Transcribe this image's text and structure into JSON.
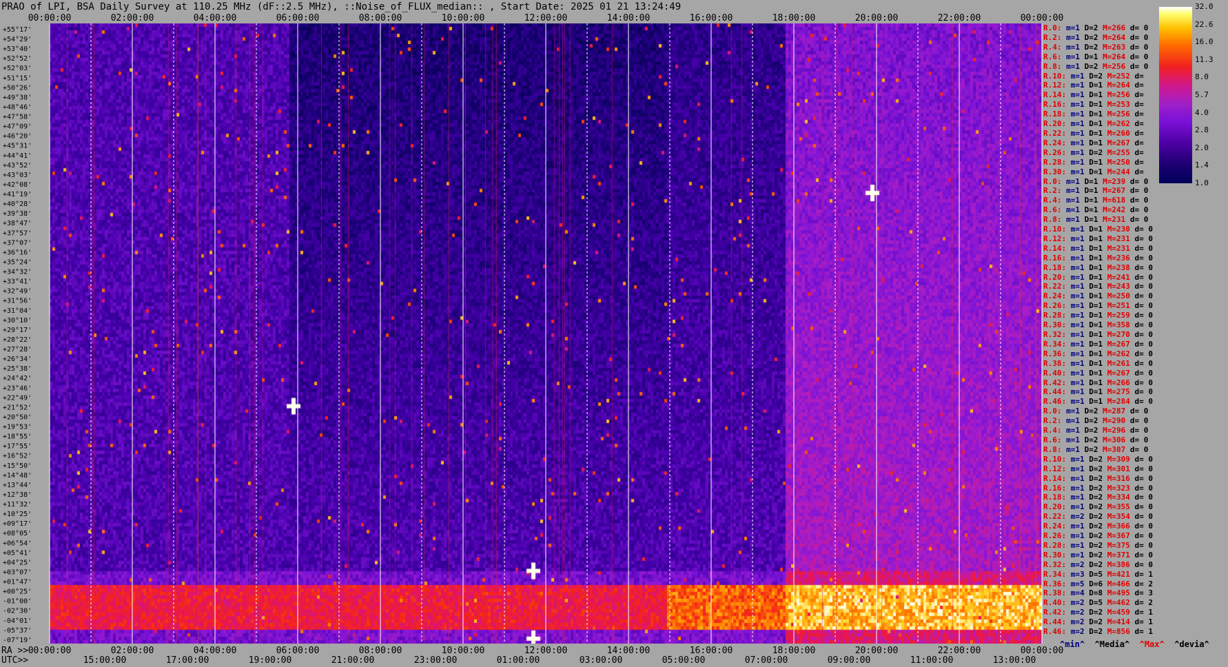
{
  "title": "PRAO of LPI, BSA Daily Survey at 110.25 MHz (dF::2.5 MHz), ::Noise_of_FLUX_median:: , Start Date: 2025 01 21 13:24:49",
  "colorbar": {
    "ticks": [
      "32.0",
      "22.6",
      "16.0",
      "11.3",
      "8.0",
      "5.7",
      "4.0",
      "2.8",
      "2.0",
      "1.4",
      "1.0"
    ]
  },
  "bottom_legend": {
    "min": "^min^",
    "median": "^Media^",
    "max": "^Max^",
    "devia": "^devia^"
  },
  "axis": {
    "ra_label": "RA >>",
    "utc_label": "UTC>>",
    "top_ticks": [
      "00:00:00",
      "02:00:00",
      "04:00:00",
      "06:00:00",
      "08:00:00",
      "10:00:00",
      "12:00:00",
      "14:00:00",
      "16:00:00",
      "18:00:00",
      "20:00:00",
      "22:00:00",
      "00:00:00"
    ],
    "ra_ticks": [
      "00:00:00",
      "02:00:00",
      "04:00:00",
      "06:00:00",
      "08:00:00",
      "10:00:00",
      "12:00:00",
      "14:00:00",
      "16:00:00",
      "18:00:00",
      "20:00:00",
      "22:00:00",
      "00:00:00"
    ],
    "utc_ticks": [
      "15:00:00",
      "17:00:00",
      "19:00:00",
      "21:00:00",
      "23:00:00",
      "01:00:00",
      "03:00:00",
      "05:00:00",
      "07:00:00",
      "09:00:00",
      "11:00:00",
      "13:00:00"
    ]
  },
  "declinations": [
    "+55°17'",
    "+54°29'",
    "+53°40'",
    "+52°52'",
    "+52°03'",
    "+51°15'",
    "+50°26'",
    "+49°38'",
    "+48°46'",
    "+47°58'",
    "+47°09'",
    "+46°20'",
    "+45°31'",
    "+44°41'",
    "+43°52'",
    "+43°03'",
    "+42°08'",
    "+41°19'",
    "+40°28'",
    "+39°38'",
    "+38°47'",
    "+37°57'",
    "+37°07'",
    "+36°16'",
    "+35°24'",
    "+34°32'",
    "+33°41'",
    "+32°49'",
    "+31°56'",
    "+31°04'",
    "+30°10'",
    "+29°17'",
    "+28°22'",
    "+27°28'",
    "+26°34'",
    "+25°38'",
    "+24°42'",
    "+23°46'",
    "+22°49'",
    "+21°52'",
    "+20°50'",
    "+19°53'",
    "+18°55'",
    "+17°55'",
    "+16°52'",
    "+15°50'",
    "+14°48'",
    "+13°44'",
    "+12°38'",
    "+11°32'",
    "+10°25'",
    "+09°17'",
    "+08°05'",
    "+06°54'",
    "+05°41'",
    "+04°25'",
    "+03°07'",
    "+01°47'",
    "+00°25'",
    "-01°00'",
    "-02°30'",
    "-04°01'",
    "-05°37'",
    "-07°19'"
  ],
  "right_rows": [
    {
      "r": "R.0:",
      "m": "m=1",
      "d": "D=2",
      "h": "M=266",
      "v": "d= 0"
    },
    {
      "r": "R.2:",
      "m": "m=1",
      "d": "D=2",
      "h": "M=264",
      "v": "d= 0"
    },
    {
      "r": "R.4:",
      "m": "m=1",
      "d": "D=2",
      "h": "M=263",
      "v": "d= 0"
    },
    {
      "r": "R.6:",
      "m": "m=1",
      "d": "D=1",
      "h": "M=264",
      "v": "d= 0"
    },
    {
      "r": "R.8:",
      "m": "m=1",
      "d": "D=2",
      "h": "M=256",
      "v": "d= 0"
    },
    {
      "r": "R.10:",
      "m": "m=1",
      "d": "D=2",
      "h": "M=252",
      "v": "d="
    },
    {
      "r": "R.12:",
      "m": "m=1",
      "d": "D=1",
      "h": "M=264",
      "v": "d="
    },
    {
      "r": "R.14:",
      "m": "m=1",
      "d": "D=1",
      "h": "M=256",
      "v": "d="
    },
    {
      "r": "R.16:",
      "m": "m=1",
      "d": "D=1",
      "h": "M=253",
      "v": "d="
    },
    {
      "r": "R.18:",
      "m": "m=1",
      "d": "D=1",
      "h": "M=256",
      "v": "d="
    },
    {
      "r": "R.20:",
      "m": "m=1",
      "d": "D=1",
      "h": "M=262",
      "v": "d="
    },
    {
      "r": "R.22:",
      "m": "m=1",
      "d": "D=1",
      "h": "M=260",
      "v": "d="
    },
    {
      "r": "R.24:",
      "m": "m=1",
      "d": "D=1",
      "h": "M=267",
      "v": "d="
    },
    {
      "r": "R.26:",
      "m": "m=1",
      "d": "D=2",
      "h": "M=255",
      "v": "d="
    },
    {
      "r": "R.28:",
      "m": "m=1",
      "d": "D=1",
      "h": "M=250",
      "v": "d="
    },
    {
      "r": "R.30:",
      "m": "m=1",
      "d": "D=1",
      "h": "M=244",
      "v": "d="
    },
    {
      "r": "R.0:",
      "m": "m=1",
      "d": "D=1",
      "h": "M=239",
      "v": "d= 0"
    },
    {
      "r": "R.2:",
      "m": "m=1",
      "d": "D=1",
      "h": "M=267",
      "v": "d= 0"
    },
    {
      "r": "R.4:",
      "m": "m=1",
      "d": "D=1",
      "h": "M=618",
      "v": "d= 0"
    },
    {
      "r": "R.6:",
      "m": "m=1",
      "d": "D=1",
      "h": "M=242",
      "v": "d= 0"
    },
    {
      "r": "R.8:",
      "m": "m=1",
      "d": "D=1",
      "h": "M=231",
      "v": "d= 0"
    },
    {
      "r": "R.10:",
      "m": "m=1",
      "d": "D=1",
      "h": "M=230",
      "v": "d= 0"
    },
    {
      "r": "R.12:",
      "m": "m=1",
      "d": "D=1",
      "h": "M=231",
      "v": "d= 0"
    },
    {
      "r": "R.14:",
      "m": "m=1",
      "d": "D=1",
      "h": "M=231",
      "v": "d= 0"
    },
    {
      "r": "R.16:",
      "m": "m=1",
      "d": "D=1",
      "h": "M=236",
      "v": "d= 0"
    },
    {
      "r": "R.18:",
      "m": "m=1",
      "d": "D=1",
      "h": "M=238",
      "v": "d= 0"
    },
    {
      "r": "R.20:",
      "m": "m=1",
      "d": "D=1",
      "h": "M=241",
      "v": "d= 0"
    },
    {
      "r": "R.22:",
      "m": "m=1",
      "d": "D=1",
      "h": "M=243",
      "v": "d= 0"
    },
    {
      "r": "R.24:",
      "m": "m=1",
      "d": "D=1",
      "h": "M=250",
      "v": "d= 0"
    },
    {
      "r": "R.26:",
      "m": "m=1",
      "d": "D=1",
      "h": "M=251",
      "v": "d= 0"
    },
    {
      "r": "R.28:",
      "m": "m=1",
      "d": "D=1",
      "h": "M=259",
      "v": "d= 0"
    },
    {
      "r": "R.30:",
      "m": "m=1",
      "d": "D=1",
      "h": "M=358",
      "v": "d= 0"
    },
    {
      "r": "R.32:",
      "m": "m=1",
      "d": "D=1",
      "h": "M=270",
      "v": "d= 0"
    },
    {
      "r": "R.34:",
      "m": "m=1",
      "d": "D=1",
      "h": "M=267",
      "v": "d= 0"
    },
    {
      "r": "R.36:",
      "m": "m=1",
      "d": "D=1",
      "h": "M=262",
      "v": "d= 0"
    },
    {
      "r": "R.38:",
      "m": "m=1",
      "d": "D=1",
      "h": "M=261",
      "v": "d= 0"
    },
    {
      "r": "R.40:",
      "m": "m=1",
      "d": "D=1",
      "h": "M=267",
      "v": "d= 0"
    },
    {
      "r": "R.42:",
      "m": "m=1",
      "d": "D=1",
      "h": "M=266",
      "v": "d= 0"
    },
    {
      "r": "R.44:",
      "m": "m=1",
      "d": "D=1",
      "h": "M=275",
      "v": "d= 0"
    },
    {
      "r": "R.46:",
      "m": "m=1",
      "d": "D=1",
      "h": "M=284",
      "v": "d= 0"
    },
    {
      "r": "R.0:",
      "m": "m=1",
      "d": "D=2",
      "h": "M=287",
      "v": "d= 0"
    },
    {
      "r": "R.2:",
      "m": "m=1",
      "d": "D=2",
      "h": "M=290",
      "v": "d= 0"
    },
    {
      "r": "R.4:",
      "m": "m=1",
      "d": "D=2",
      "h": "M=296",
      "v": "d= 0"
    },
    {
      "r": "R.6:",
      "m": "m=1",
      "d": "D=2",
      "h": "M=306",
      "v": "d= 0"
    },
    {
      "r": "R.8:",
      "m": "m=1",
      "d": "D=2",
      "h": "M=307",
      "v": "d= 0"
    },
    {
      "r": "R.10:",
      "m": "m=1",
      "d": "D=2",
      "h": "M=309",
      "v": "d= 0"
    },
    {
      "r": "R.12:",
      "m": "m=1",
      "d": "D=2",
      "h": "M=301",
      "v": "d= 0"
    },
    {
      "r": "R.14:",
      "m": "m=1",
      "d": "D=2",
      "h": "M=316",
      "v": "d= 0"
    },
    {
      "r": "R.16:",
      "m": "m=1",
      "d": "D=2",
      "h": "M=323",
      "v": "d= 0"
    },
    {
      "r": "R.18:",
      "m": "m=1",
      "d": "D=2",
      "h": "M=334",
      "v": "d= 0"
    },
    {
      "r": "R.20:",
      "m": "m=1",
      "d": "D=2",
      "h": "M=355",
      "v": "d= 0"
    },
    {
      "r": "R.22:",
      "m": "m=2",
      "d": "D=2",
      "h": "M=354",
      "v": "d= 0"
    },
    {
      "r": "R.24:",
      "m": "m=1",
      "d": "D=2",
      "h": "M=366",
      "v": "d= 0"
    },
    {
      "r": "R.26:",
      "m": "m=1",
      "d": "D=2",
      "h": "M=367",
      "v": "d= 0"
    },
    {
      "r": "R.28:",
      "m": "m=1",
      "d": "D=2",
      "h": "M=375",
      "v": "d= 0"
    },
    {
      "r": "R.30:",
      "m": "m=1",
      "d": "D=2",
      "h": "M=371",
      "v": "d= 0"
    },
    {
      "r": "R.32:",
      "m": "m=2",
      "d": "D=2",
      "h": "M=386",
      "v": "d= 0"
    },
    {
      "r": "R.34:",
      "m": "m=3",
      "d": "D=5",
      "h": "M=421",
      "v": "d= 1"
    },
    {
      "r": "R.36:",
      "m": "m=5",
      "d": "D=6",
      "h": "M=466",
      "v": "d= 2"
    },
    {
      "r": "R.38:",
      "m": "m=4",
      "d": "D=8",
      "h": "M=495",
      "v": "d= 3"
    },
    {
      "r": "R.40:",
      "m": "m=2",
      "d": "D=5",
      "h": "M=462",
      "v": "d= 2"
    },
    {
      "r": "R.42:",
      "m": "m=2",
      "d": "D=2",
      "h": "M=459",
      "v": "d= 1"
    },
    {
      "r": "R.44:",
      "m": "m=2",
      "d": "D=2",
      "h": "M=414",
      "v": "d= 1"
    },
    {
      "r": "R.46:",
      "m": "m=2",
      "d": "D=2",
      "h": "M=856",
      "v": "d= 1"
    }
  ],
  "chart_data": {
    "type": "heatmap",
    "title": "PRAO of LPI, BSA Daily Survey at 110.25 MHz (dF::2.5 MHz), ::Noise_of_FLUX_median:: , Start Date: 2025 01 21 13:24:49",
    "x_axis_ra_hours": [
      0,
      24
    ],
    "y_axis": "declination",
    "colorbar_range": [
      1.0,
      32.0
    ],
    "colorbar_scale": "log",
    "bright_sources": [
      {
        "ra_h": 19.9,
        "dec": "+41°19'",
        "level": 32
      },
      {
        "ra_h": 11.7,
        "dec": "+03°07'",
        "level": 32
      },
      {
        "ra_h": 11.7,
        "dec": "-07°19'",
        "level": 32
      },
      {
        "ra_h": 5.9,
        "dec": "+21°52'",
        "level": 22.6
      }
    ]
  }
}
